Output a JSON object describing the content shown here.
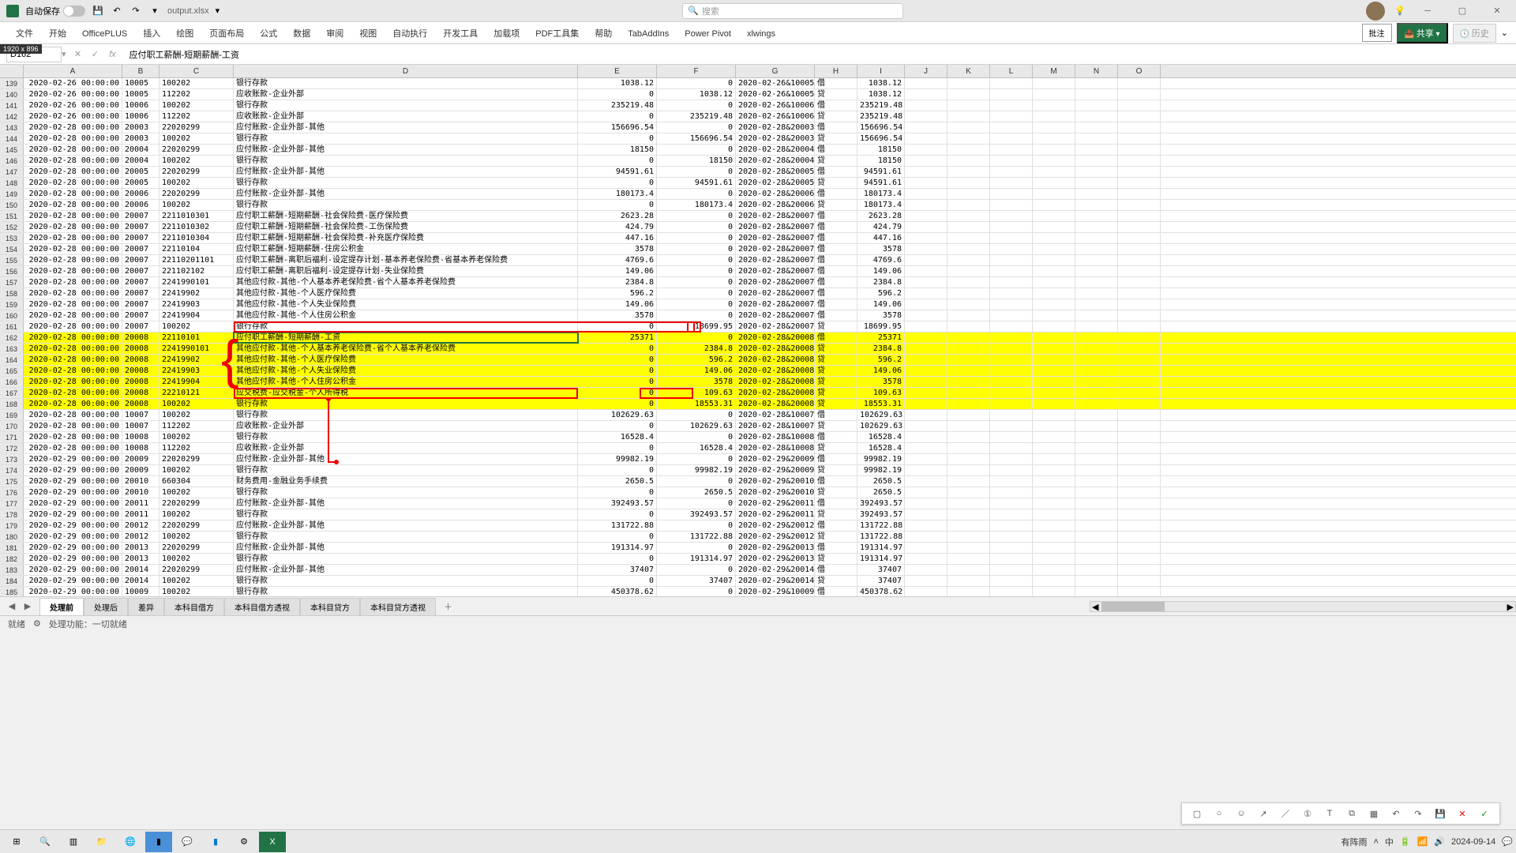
{
  "title_bar": {
    "auto_save": "自动保存",
    "file_name": "output.xlsx",
    "search_placeholder": "搜索"
  },
  "ribbon": {
    "tabs": [
      "文件",
      "开始",
      "OfficePLUS",
      "插入",
      "绘图",
      "页面布局",
      "公式",
      "数据",
      "审阅",
      "视图",
      "自动执行",
      "开发工具",
      "加载项",
      "PDF工具集",
      "帮助",
      "TabAddIns",
      "Power Pivot",
      "xlwings"
    ],
    "comments": "批注",
    "share": "共享",
    "history": "历史"
  },
  "formula": {
    "cell": "D162",
    "badge": "1920 x 896",
    "value": "应付职工薪酬-短期薪酬-工资"
  },
  "cols": [
    "A",
    "B",
    "C",
    "D",
    "E",
    "F",
    "G",
    "H",
    "I",
    "J",
    "K",
    "L",
    "M",
    "N",
    "O"
  ],
  "rows": [
    {
      "n": 139,
      "a": "2020-02-26 00:00:00",
      "b": "10005",
      "c": "100202",
      "d": "银行存款",
      "e": "1038.12",
      "f": "0",
      "g": "2020-02-26&10005",
      "h": "借",
      "i": "1038.12"
    },
    {
      "n": 140,
      "a": "2020-02-26 00:00:00",
      "b": "10005",
      "c": "112202",
      "d": "应收账款-企业外部",
      "e": "0",
      "f": "1038.12",
      "g": "2020-02-26&10005",
      "h": "贷",
      "i": "1038.12"
    },
    {
      "n": 141,
      "a": "2020-02-26 00:00:00",
      "b": "10006",
      "c": "100202",
      "d": "银行存款",
      "e": "235219.48",
      "f": "0",
      "g": "2020-02-26&10006",
      "h": "借",
      "i": "235219.48"
    },
    {
      "n": 142,
      "a": "2020-02-26 00:00:00",
      "b": "10006",
      "c": "112202",
      "d": "应收账款-企业外部",
      "e": "0",
      "f": "235219.48",
      "g": "2020-02-26&10006",
      "h": "贷",
      "i": "235219.48"
    },
    {
      "n": 143,
      "a": "2020-02-28 00:00:00",
      "b": "20003",
      "c": "22020299",
      "d": "应付账款-企业外部-其他",
      "e": "156696.54",
      "f": "0",
      "g": "2020-02-28&20003",
      "h": "借",
      "i": "156696.54"
    },
    {
      "n": 144,
      "a": "2020-02-28 00:00:00",
      "b": "20003",
      "c": "100202",
      "d": "银行存款",
      "e": "0",
      "f": "156696.54",
      "g": "2020-02-28&20003",
      "h": "贷",
      "i": "156696.54"
    },
    {
      "n": 145,
      "a": "2020-02-28 00:00:00",
      "b": "20004",
      "c": "22020299",
      "d": "应付账款-企业外部-其他",
      "e": "18150",
      "f": "0",
      "g": "2020-02-28&20004",
      "h": "借",
      "i": "18150"
    },
    {
      "n": 146,
      "a": "2020-02-28 00:00:00",
      "b": "20004",
      "c": "100202",
      "d": "银行存款",
      "e": "0",
      "f": "18150",
      "g": "2020-02-28&20004",
      "h": "贷",
      "i": "18150"
    },
    {
      "n": 147,
      "a": "2020-02-28 00:00:00",
      "b": "20005",
      "c": "22020299",
      "d": "应付账款-企业外部-其他",
      "e": "94591.61",
      "f": "0",
      "g": "2020-02-28&20005",
      "h": "借",
      "i": "94591.61"
    },
    {
      "n": 148,
      "a": "2020-02-28 00:00:00",
      "b": "20005",
      "c": "100202",
      "d": "银行存款",
      "e": "0",
      "f": "94591.61",
      "g": "2020-02-28&20005",
      "h": "贷",
      "i": "94591.61"
    },
    {
      "n": 149,
      "a": "2020-02-28 00:00:00",
      "b": "20006",
      "c": "22020299",
      "d": "应付账款-企业外部-其他",
      "e": "180173.4",
      "f": "0",
      "g": "2020-02-28&20006",
      "h": "借",
      "i": "180173.4"
    },
    {
      "n": 150,
      "a": "2020-02-28 00:00:00",
      "b": "20006",
      "c": "100202",
      "d": "银行存款",
      "e": "0",
      "f": "180173.4",
      "g": "2020-02-28&20006",
      "h": "贷",
      "i": "180173.4"
    },
    {
      "n": 151,
      "a": "2020-02-28 00:00:00",
      "b": "20007",
      "c": "2211010301",
      "d": "应付职工薪酬-短期薪酬-社会保险费-医疗保险费",
      "e": "2623.28",
      "f": "0",
      "g": "2020-02-28&20007",
      "h": "借",
      "i": "2623.28"
    },
    {
      "n": 152,
      "a": "2020-02-28 00:00:00",
      "b": "20007",
      "c": "2211010302",
      "d": "应付职工薪酬-短期薪酬-社会保险费-工伤保险费",
      "e": "424.79",
      "f": "0",
      "g": "2020-02-28&20007",
      "h": "借",
      "i": "424.79"
    },
    {
      "n": 153,
      "a": "2020-02-28 00:00:00",
      "b": "20007",
      "c": "2211010304",
      "d": "应付职工薪酬-短期薪酬-社会保险费-补充医疗保险费",
      "e": "447.16",
      "f": "0",
      "g": "2020-02-28&20007",
      "h": "借",
      "i": "447.16"
    },
    {
      "n": 154,
      "a": "2020-02-28 00:00:00",
      "b": "20007",
      "c": "22110104",
      "d": "应付职工薪酬-短期薪酬-住房公积金",
      "e": "3578",
      "f": "0",
      "g": "2020-02-28&20007",
      "h": "借",
      "i": "3578"
    },
    {
      "n": 155,
      "a": "2020-02-28 00:00:00",
      "b": "20007",
      "c": "22110201101",
      "d": "应付职工薪酬-离职后福利-设定提存计划-基本养老保险费-省基本养老保险费",
      "e": "4769.6",
      "f": "0",
      "g": "2020-02-28&20007",
      "h": "借",
      "i": "4769.6"
    },
    {
      "n": 156,
      "a": "2020-02-28 00:00:00",
      "b": "20007",
      "c": "221102102",
      "d": "应付职工薪酬-离职后福利-设定提存计划-失业保险费",
      "e": "149.06",
      "f": "0",
      "g": "2020-02-28&20007",
      "h": "借",
      "i": "149.06"
    },
    {
      "n": 157,
      "a": "2020-02-28 00:00:00",
      "b": "20007",
      "c": "2241990101",
      "d": "其他应付款-其他-个人基本养老保险费-省个人基本养老保险费",
      "e": "2384.8",
      "f": "0",
      "g": "2020-02-28&20007",
      "h": "借",
      "i": "2384.8"
    },
    {
      "n": 158,
      "a": "2020-02-28 00:00:00",
      "b": "20007",
      "c": "22419902",
      "d": "其他应付款-其他-个人医疗保险费",
      "e": "596.2",
      "f": "0",
      "g": "2020-02-28&20007",
      "h": "借",
      "i": "596.2"
    },
    {
      "n": 159,
      "a": "2020-02-28 00:00:00",
      "b": "20007",
      "c": "22419903",
      "d": "其他应付款-其他-个人失业保险费",
      "e": "149.06",
      "f": "0",
      "g": "2020-02-28&20007",
      "h": "借",
      "i": "149.06"
    },
    {
      "n": 160,
      "a": "2020-02-28 00:00:00",
      "b": "20007",
      "c": "22419904",
      "d": "其他应付款-其他-个人住房公积金",
      "e": "3578",
      "f": "0",
      "g": "2020-02-28&20007",
      "h": "借",
      "i": "3578"
    },
    {
      "n": 161,
      "a": "2020-02-28 00:00:00",
      "b": "20007",
      "c": "100202",
      "d": "银行存款",
      "e": "0",
      "f": "18699.95",
      "g": "2020-02-28&20007",
      "h": "贷",
      "i": "18699.95"
    },
    {
      "n": 162,
      "a": "2020-02-28 00:00:00",
      "b": "20008",
      "c": "22110101",
      "d": "应付职工薪酬-短期薪酬-工资",
      "e": "25371",
      "f": "0",
      "g": "2020-02-28&20008",
      "h": "借",
      "i": "25371",
      "hl": 1,
      "active": 1
    },
    {
      "n": 163,
      "a": "2020-02-28 00:00:00",
      "b": "20008",
      "c": "2241990101",
      "d": "其他应付款-其他-个人基本养老保险费-省个人基本养老保险费",
      "e": "0",
      "f": "2384.8",
      "g": "2020-02-28&20008",
      "h": "贷",
      "i": "2384.8",
      "hl": 1
    },
    {
      "n": 164,
      "a": "2020-02-28 00:00:00",
      "b": "20008",
      "c": "22419902",
      "d": "其他应付款-其他-个人医疗保险费",
      "e": "0",
      "f": "596.2",
      "g": "2020-02-28&20008",
      "h": "贷",
      "i": "596.2",
      "hl": 1
    },
    {
      "n": 165,
      "a": "2020-02-28 00:00:00",
      "b": "20008",
      "c": "22419903",
      "d": "其他应付款-其他-个人失业保险费",
      "e": "0",
      "f": "149.06",
      "g": "2020-02-28&20008",
      "h": "贷",
      "i": "149.06",
      "hl": 1
    },
    {
      "n": 166,
      "a": "2020-02-28 00:00:00",
      "b": "20008",
      "c": "22419904",
      "d": "其他应付款-其他-个人住房公积金",
      "e": "0",
      "f": "3578",
      "g": "2020-02-28&20008",
      "h": "贷",
      "i": "3578",
      "hl": 1
    },
    {
      "n": 167,
      "a": "2020-02-28 00:00:00",
      "b": "20008",
      "c": "22210121",
      "d": "应交税费-应交税金-个人所得税",
      "e": "0",
      "f": "109.63",
      "g": "2020-02-28&20008",
      "h": "贷",
      "i": "109.63",
      "hl": 1
    },
    {
      "n": 168,
      "a": "2020-02-28 00:00:00",
      "b": "20008",
      "c": "100202",
      "d": "银行存款",
      "e": "0",
      "f": "18553.31",
      "g": "2020-02-28&20008",
      "h": "贷",
      "i": "18553.31",
      "hl": 1
    },
    {
      "n": 169,
      "a": "2020-02-28 00:00:00",
      "b": "10007",
      "c": "100202",
      "d": "银行存款",
      "e": "102629.63",
      "f": "0",
      "g": "2020-02-28&10007",
      "h": "借",
      "i": "102629.63"
    },
    {
      "n": 170,
      "a": "2020-02-28 00:00:00",
      "b": "10007",
      "c": "112202",
      "d": "应收账款-企业外部",
      "e": "0",
      "f": "102629.63",
      "g": "2020-02-28&10007",
      "h": "贷",
      "i": "102629.63"
    },
    {
      "n": 171,
      "a": "2020-02-28 00:00:00",
      "b": "10008",
      "c": "100202",
      "d": "银行存款",
      "e": "16528.4",
      "f": "0",
      "g": "2020-02-28&10008",
      "h": "借",
      "i": "16528.4"
    },
    {
      "n": 172,
      "a": "2020-02-28 00:00:00",
      "b": "10008",
      "c": "112202",
      "d": "应收账款-企业外部",
      "e": "0",
      "f": "16528.4",
      "g": "2020-02-28&10008",
      "h": "贷",
      "i": "16528.4"
    },
    {
      "n": 173,
      "a": "2020-02-29 00:00:00",
      "b": "20009",
      "c": "22020299",
      "d": "应付账款-企业外部-其他",
      "e": "99982.19",
      "f": "0",
      "g": "2020-02-29&20009",
      "h": "借",
      "i": "99982.19"
    },
    {
      "n": 174,
      "a": "2020-02-29 00:00:00",
      "b": "20009",
      "c": "100202",
      "d": "银行存款",
      "e": "0",
      "f": "99982.19",
      "g": "2020-02-29&20009",
      "h": "贷",
      "i": "99982.19"
    },
    {
      "n": 175,
      "a": "2020-02-29 00:00:00",
      "b": "20010",
      "c": "660304",
      "d": "财务费用-金融业务手续费",
      "e": "2650.5",
      "f": "0",
      "g": "2020-02-29&20010",
      "h": "借",
      "i": "2650.5"
    },
    {
      "n": 176,
      "a": "2020-02-29 00:00:00",
      "b": "20010",
      "c": "100202",
      "d": "银行存款",
      "e": "0",
      "f": "2650.5",
      "g": "2020-02-29&20010",
      "h": "贷",
      "i": "2650.5"
    },
    {
      "n": 177,
      "a": "2020-02-29 00:00:00",
      "b": "20011",
      "c": "22020299",
      "d": "应付账款-企业外部-其他",
      "e": "392493.57",
      "f": "0",
      "g": "2020-02-29&20011",
      "h": "借",
      "i": "392493.57"
    },
    {
      "n": 178,
      "a": "2020-02-29 00:00:00",
      "b": "20011",
      "c": "100202",
      "d": "银行存款",
      "e": "0",
      "f": "392493.57",
      "g": "2020-02-29&20011",
      "h": "贷",
      "i": "392493.57"
    },
    {
      "n": 179,
      "a": "2020-02-29 00:00:00",
      "b": "20012",
      "c": "22020299",
      "d": "应付账款-企业外部-其他",
      "e": "131722.88",
      "f": "0",
      "g": "2020-02-29&20012",
      "h": "借",
      "i": "131722.88"
    },
    {
      "n": 180,
      "a": "2020-02-29 00:00:00",
      "b": "20012",
      "c": "100202",
      "d": "银行存款",
      "e": "0",
      "f": "131722.88",
      "g": "2020-02-29&20012",
      "h": "贷",
      "i": "131722.88"
    },
    {
      "n": 181,
      "a": "2020-02-29 00:00:00",
      "b": "20013",
      "c": "22020299",
      "d": "应付账款-企业外部-其他",
      "e": "191314.97",
      "f": "0",
      "g": "2020-02-29&20013",
      "h": "借",
      "i": "191314.97"
    },
    {
      "n": 182,
      "a": "2020-02-29 00:00:00",
      "b": "20013",
      "c": "100202",
      "d": "银行存款",
      "e": "0",
      "f": "191314.97",
      "g": "2020-02-29&20013",
      "h": "贷",
      "i": "191314.97"
    },
    {
      "n": 183,
      "a": "2020-02-29 00:00:00",
      "b": "20014",
      "c": "22020299",
      "d": "应付账款-企业外部-其他",
      "e": "37407",
      "f": "0",
      "g": "2020-02-29&20014",
      "h": "借",
      "i": "37407"
    },
    {
      "n": 184,
      "a": "2020-02-29 00:00:00",
      "b": "20014",
      "c": "100202",
      "d": "银行存款",
      "e": "0",
      "f": "37407",
      "g": "2020-02-29&20014",
      "h": "贷",
      "i": "37407"
    },
    {
      "n": 185,
      "a": "2020-02-29 00:00:00",
      "b": "10009",
      "c": "100202",
      "d": "银行存款",
      "e": "450378.62",
      "f": "0",
      "g": "2020-02-29&10009",
      "h": "借",
      "i": "450378.62"
    }
  ],
  "sheets": [
    "处理前",
    "处理后",
    "差异",
    "本科目借方",
    "本科目借方透视",
    "本科目贷方",
    "本科目贷方透视"
  ],
  "status": {
    "ready": "就绪",
    "processing": "处理功能：一切就绪"
  },
  "taskbar": {
    "date": "2024-09-14",
    "weather": "有阵雨"
  }
}
